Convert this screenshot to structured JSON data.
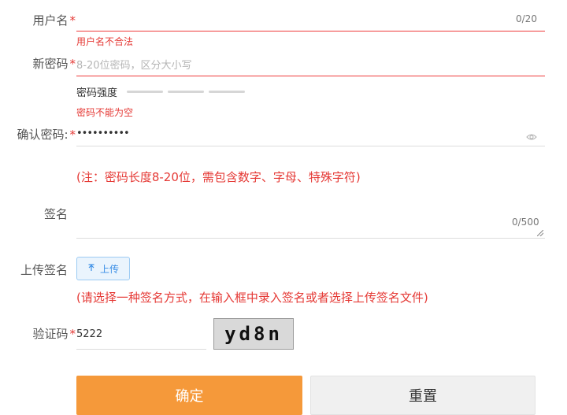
{
  "form": {
    "required_mark": "*",
    "username": {
      "label": "用户名",
      "counter": "0/20",
      "error": "用户名不合法"
    },
    "new_password": {
      "label": "新密码",
      "placeholder": "8-20位密码，区分大小写",
      "strength_label": "密码强度",
      "strength_levels_filled": 0,
      "strength_levels_total": 3,
      "error": "密码不能为空"
    },
    "confirm_password": {
      "label": "确认密码:",
      "value": "••••••••••"
    },
    "password_note": "(注：密码长度8-20位，需包含数字、字母、特殊字符)",
    "signature": {
      "label": "签名",
      "counter": "0/500"
    },
    "upload_signature": {
      "label": "上传签名",
      "button_label": "上传",
      "note": "(请选择一种签名方式，在输入框中录入签名或者选择上传签名文件)"
    },
    "captcha": {
      "label": "验证码",
      "value": "5222",
      "image_text": "yd8n"
    },
    "buttons": {
      "confirm": "确定",
      "reset": "重置"
    }
  },
  "colors": {
    "error": "#e53935",
    "accent": "#f5993a",
    "upload": "#3a8ee6"
  }
}
